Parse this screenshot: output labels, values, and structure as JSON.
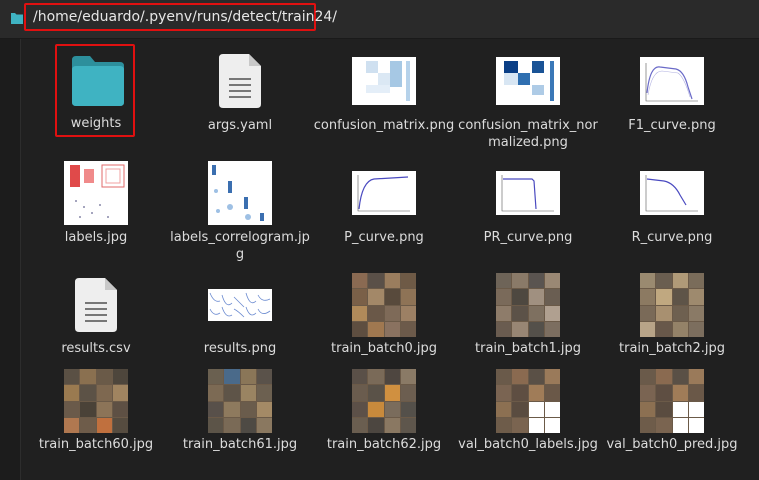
{
  "path_bar": {
    "path": "/home/eduardo/.pyenv/runs/detect/train24/"
  },
  "files": [
    {
      "name": "weights",
      "kind": "folder",
      "selected": true
    },
    {
      "name": "args.yaml",
      "kind": "text"
    },
    {
      "name": "confusion_matrix.png",
      "kind": "image"
    },
    {
      "name": "confusion_matrix_normalized.png",
      "kind": "image"
    },
    {
      "name": "F1_curve.png",
      "kind": "image"
    },
    {
      "name": "labels.jpg",
      "kind": "image"
    },
    {
      "name": "labels_correlogram.jpg",
      "kind": "image"
    },
    {
      "name": "P_curve.png",
      "kind": "image"
    },
    {
      "name": "PR_curve.png",
      "kind": "image"
    },
    {
      "name": "R_curve.png",
      "kind": "image"
    },
    {
      "name": "results.csv",
      "kind": "text"
    },
    {
      "name": "results.png",
      "kind": "image"
    },
    {
      "name": "train_batch0.jpg",
      "kind": "image"
    },
    {
      "name": "train_batch1.jpg",
      "kind": "image"
    },
    {
      "name": "train_batch2.jpg",
      "kind": "image"
    },
    {
      "name": "train_batch60.jpg",
      "kind": "image"
    },
    {
      "name": "train_batch61.jpg",
      "kind": "image"
    },
    {
      "name": "train_batch62.jpg",
      "kind": "image"
    },
    {
      "name": "val_batch0_labels.jpg",
      "kind": "image"
    },
    {
      "name": "val_batch0_pred.jpg",
      "kind": "image"
    }
  ],
  "colors": {
    "folder": "#3fb3c2",
    "highlight": "#e01010"
  }
}
